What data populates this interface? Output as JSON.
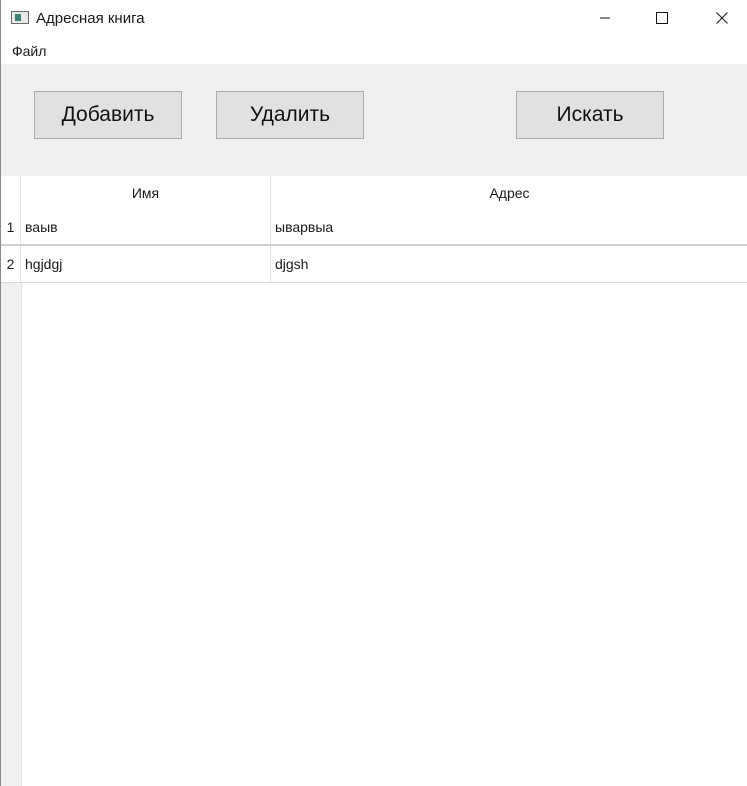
{
  "window": {
    "title": "Адресная книга",
    "icon": "app-window-icon",
    "controls": {
      "minimize": "minimize-icon",
      "maximize": "maximize-icon",
      "close": "close-icon"
    }
  },
  "menu": {
    "items": [
      {
        "label": "Файл"
      }
    ]
  },
  "toolbar": {
    "add_label": "Добавить",
    "delete_label": "Удалить",
    "search_label": "Искать"
  },
  "table": {
    "columns": [
      "Имя",
      "Адрес"
    ],
    "rows": [
      {
        "num": "1",
        "name": "ваыв",
        "address": "ыварвыа"
      },
      {
        "num": "2",
        "name": "hgjdgj",
        "address": "djgsh"
      }
    ]
  }
}
